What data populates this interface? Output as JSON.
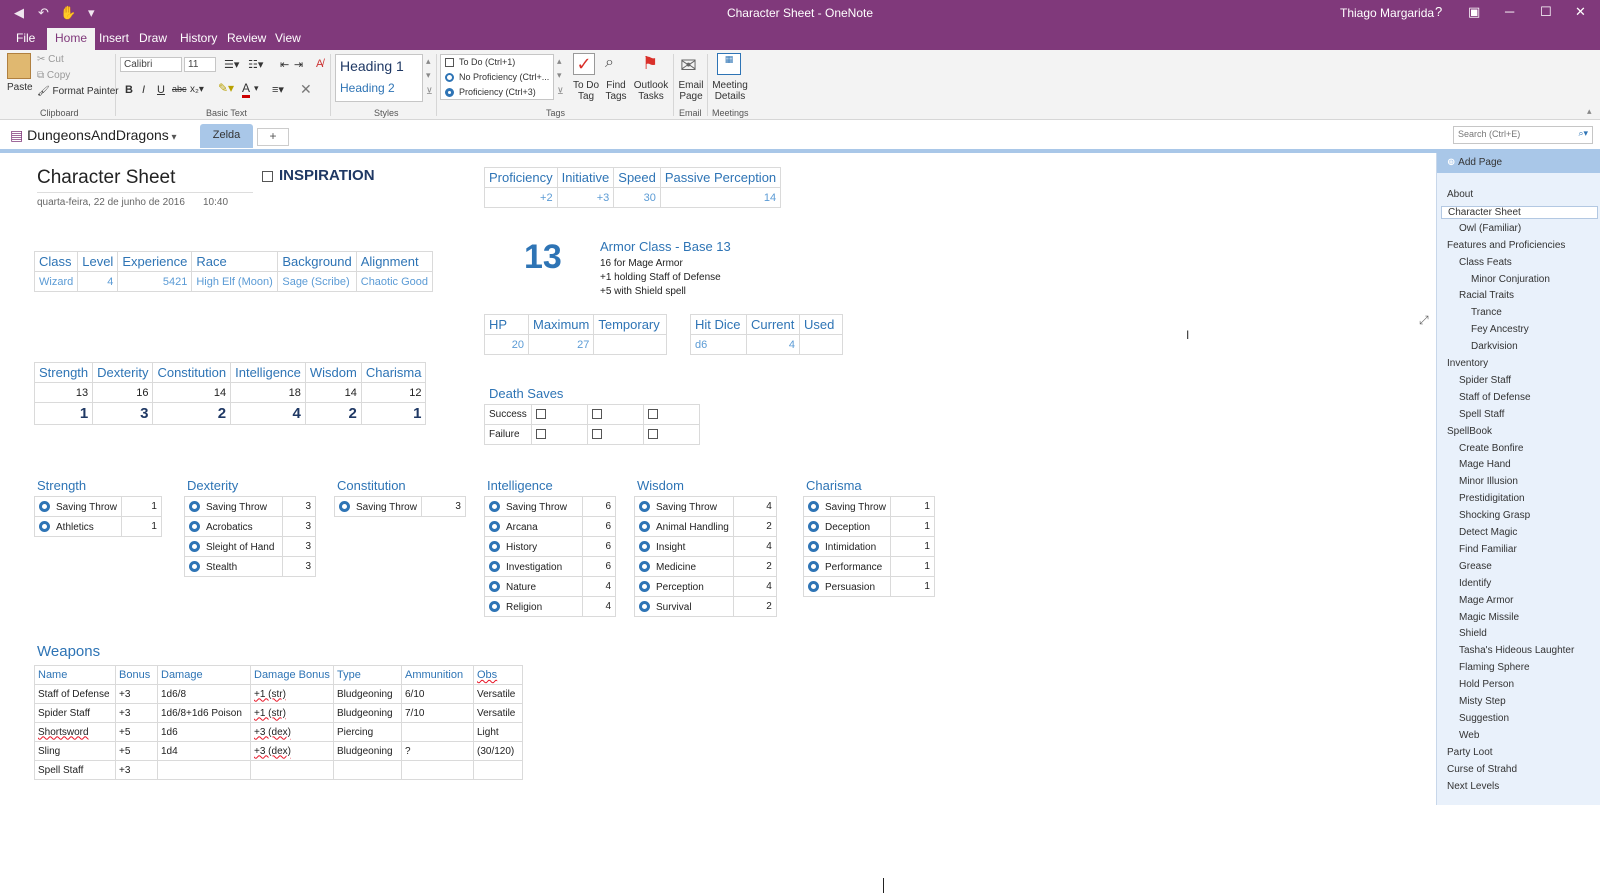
{
  "window": {
    "title": "Character Sheet - OneNote",
    "user": "Thiago Margarida",
    "help": "?",
    "minimize": "─",
    "maximize": "☐",
    "close": "✕"
  },
  "menu": {
    "tabs": [
      "File",
      "Home",
      "Insert",
      "Draw",
      "History",
      "Review",
      "View"
    ],
    "active": "Home"
  },
  "ribbon": {
    "paste": "Paste",
    "cut": "Cut",
    "copy": "Copy",
    "format_painter": "Format Painter",
    "clipboard_label": "Clipboard",
    "font_name": "Calibri",
    "font_size": "11",
    "basic_text_label": "Basic Text",
    "heading1": "Heading 1",
    "heading2": "Heading 2",
    "styles_label": "Styles",
    "tag_todo": "To Do (Ctrl+1)",
    "tag_noprof": "No Proficiency (Ctrl+...",
    "tag_prof": "Proficiency (Ctrl+3)",
    "todo_tag": "To Do Tag",
    "find_tags": "Find Tags",
    "outlook_tasks": "Outlook Tasks",
    "tags_label": "Tags",
    "email_page": "Email Page",
    "email_label": "Email",
    "meeting_details": "Meeting Details",
    "meetings_label": "Meetings"
  },
  "notebook": {
    "name": "DungeonsAndDragons",
    "section": "Zelda",
    "add_section": "+",
    "search_placeholder": "Search (Ctrl+E)"
  },
  "page": {
    "title": "Character Sheet",
    "date": "quarta-feira, 22 de junho de 2016",
    "time": "10:40",
    "inspiration": "INSPIRATION",
    "class_table": {
      "headers": [
        "Class",
        "Level",
        "Experience",
        "Race",
        "Background",
        "Alignment"
      ],
      "values": [
        "Wizard",
        "4",
        "5421",
        "High Elf (Moon)",
        "Sage (Scribe)",
        "Chaotic Good"
      ]
    },
    "prof_table": {
      "headers": [
        "Proficiency",
        "Initiative",
        "Speed",
        "Passive Perception"
      ],
      "values": [
        "+2",
        "+3",
        "30",
        "14"
      ]
    },
    "armor": {
      "value": "13",
      "title": "Armor Class - Base 13",
      "lines": [
        "16 for Mage Armor",
        "+1 holding Staff of Defense",
        "+5 with Shield spell"
      ]
    },
    "hp_table": {
      "headers": [
        "HP",
        "Maximum",
        "Temporary"
      ],
      "values": [
        "20",
        "27",
        ""
      ]
    },
    "hitdice_table": {
      "headers": [
        "Hit Dice",
        "Current",
        "Used"
      ],
      "values": [
        "d6",
        "4",
        ""
      ]
    },
    "abilities": {
      "headers": [
        "Strength",
        "Dexterity",
        "Constitution",
        "Intelligence",
        "Wisdom",
        "Charisma"
      ],
      "scores": [
        "13",
        "16",
        "14",
        "18",
        "14",
        "12"
      ],
      "mods": [
        "1",
        "3",
        "2",
        "4",
        "2",
        "1"
      ]
    },
    "death_saves": {
      "title": "Death Saves",
      "success": "Success",
      "failure": "Failure"
    },
    "skills": [
      {
        "title": "Strength",
        "rows": [
          [
            "Saving Throw",
            "1"
          ],
          [
            "Athletics",
            "1"
          ]
        ]
      },
      {
        "title": "Dexterity",
        "rows": [
          [
            "Saving Throw",
            "3"
          ],
          [
            "Acrobatics",
            "3"
          ],
          [
            "Sleight of Hand",
            "3"
          ],
          [
            "Stealth",
            "3"
          ]
        ]
      },
      {
        "title": "Constitution",
        "rows": [
          [
            "Saving Throw",
            "3"
          ]
        ]
      },
      {
        "title": "Intelligence",
        "rows": [
          [
            "Saving Throw",
            "6"
          ],
          [
            "Arcana",
            "6"
          ],
          [
            "History",
            "6"
          ],
          [
            "Investigation",
            "6"
          ],
          [
            "Nature",
            "4"
          ],
          [
            "Religion",
            "4"
          ]
        ]
      },
      {
        "title": "Wisdom",
        "rows": [
          [
            "Saving Throw",
            "4"
          ],
          [
            "Animal Handling",
            "2"
          ],
          [
            "Insight",
            "4"
          ],
          [
            "Medicine",
            "2"
          ],
          [
            "Perception",
            "4"
          ],
          [
            "Survival",
            "2"
          ]
        ]
      },
      {
        "title": "Charisma",
        "rows": [
          [
            "Saving Throw",
            "1"
          ],
          [
            "Deception",
            "1"
          ],
          [
            "Intimidation",
            "1"
          ],
          [
            "Performance",
            "1"
          ],
          [
            "Persuasion",
            "1"
          ]
        ]
      }
    ],
    "weapons": {
      "title": "Weapons",
      "headers": [
        "Name",
        "Bonus",
        "Damage",
        "Damage Bonus",
        "Type",
        "Ammunition",
        "Obs"
      ],
      "rows": [
        [
          "Staff of Defense",
          "+3",
          "1d6/8",
          "+1 (str)",
          "Bludgeoning",
          "6/10",
          "Versatile"
        ],
        [
          "Spider Staff",
          "+3",
          "1d6/8+1d6 Poison",
          "+1 (str)",
          "Bludgeoning",
          "7/10",
          "Versatile"
        ],
        [
          "Shortsword",
          "+5",
          "1d6",
          "+3 (dex)",
          "Piercing",
          "",
          "Light"
        ],
        [
          "Sling",
          "+5",
          "1d4",
          "+3 (dex)",
          "Bludgeoning",
          "?",
          "(30/120)"
        ],
        [
          "Spell Staff",
          "+3",
          "",
          "",
          "",
          "",
          ""
        ]
      ]
    }
  },
  "sidebar": {
    "add_page": "Add Page",
    "pages": [
      {
        "label": "About",
        "level": 0
      },
      {
        "label": "Character Sheet",
        "level": 0,
        "selected": true
      },
      {
        "label": "Owl (Familiar)",
        "level": 1
      },
      {
        "label": "Features and Proficiencies",
        "level": 0
      },
      {
        "label": "Class Feats",
        "level": 1
      },
      {
        "label": "Minor Conjuration",
        "level": 2
      },
      {
        "label": "Racial Traits",
        "level": 1
      },
      {
        "label": "Trance",
        "level": 2
      },
      {
        "label": "Fey Ancestry",
        "level": 2
      },
      {
        "label": "Darkvision",
        "level": 2
      },
      {
        "label": "Inventory",
        "level": 0
      },
      {
        "label": "Spider Staff",
        "level": 1
      },
      {
        "label": "Staff of Defense",
        "level": 1
      },
      {
        "label": "Spell Staff",
        "level": 1
      },
      {
        "label": "SpellBook",
        "level": 0
      },
      {
        "label": "Create Bonfire",
        "level": 1
      },
      {
        "label": "Mage Hand",
        "level": 1
      },
      {
        "label": "Minor Illusion",
        "level": 1
      },
      {
        "label": "Prestidigitation",
        "level": 1
      },
      {
        "label": "Shocking Grasp",
        "level": 1
      },
      {
        "label": "Detect Magic",
        "level": 1
      },
      {
        "label": "Find Familiar",
        "level": 1
      },
      {
        "label": "Grease",
        "level": 1
      },
      {
        "label": "Identify",
        "level": 1
      },
      {
        "label": "Mage Armor",
        "level": 1
      },
      {
        "label": "Magic Missile",
        "level": 1
      },
      {
        "label": "Shield",
        "level": 1
      },
      {
        "label": "Tasha's Hideous Laughter",
        "level": 1
      },
      {
        "label": "Flaming Sphere",
        "level": 1
      },
      {
        "label": "Hold Person",
        "level": 1
      },
      {
        "label": "Misty Step",
        "level": 1
      },
      {
        "label": "Suggestion",
        "level": 1
      },
      {
        "label": "Web",
        "level": 1
      },
      {
        "label": "Party Loot",
        "level": 0
      },
      {
        "label": "Curse of Strahd",
        "level": 0
      },
      {
        "label": "Next Levels",
        "level": 0
      }
    ]
  },
  "colors": {
    "brand": "#80397b",
    "accent": "#2e74b5",
    "section": "#a9c7e8"
  }
}
